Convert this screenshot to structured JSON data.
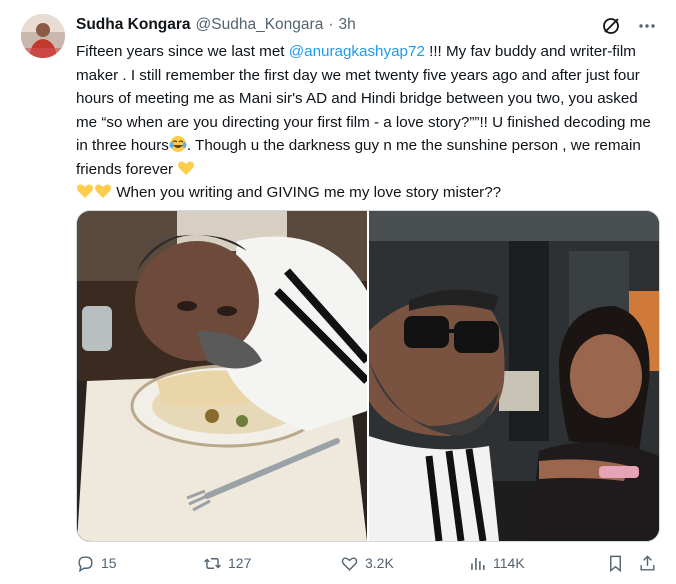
{
  "author": {
    "name": "Sudha Kongara",
    "handle": "@Sudha_Kongara",
    "separator": "·",
    "time": "3h"
  },
  "tweet": {
    "text_part1": "Fifteen years since we last met ",
    "mention": "@anuragkashyap72",
    "text_part2": " !!! My fav buddy and writer-film maker . I still remember the first day we met twenty five years ago and after just four hours of meeting me as Mani sir's AD and Hindi bridge between you two, you asked me “so when are you directing your first film - a love story?””!! U finished decoding me in three hours",
    "text_part3": ". Though u the darkness guy n me the sunshine person , we remain friends forever ",
    "text_part4": " When you writing and GIVING me my love story mister??"
  },
  "icons": {
    "grok": "grok-slash-icon",
    "more": "more-dots-icon",
    "emoji_laugh": "face-with-tears-of-joy-emoji",
    "emoji_heart": "yellow-heart-emoji"
  },
  "actions": {
    "replies": "15",
    "retweets": "127",
    "likes": "3.2K",
    "views": "114K"
  },
  "colors": {
    "accent": "#1d9bf0",
    "secondary_text": "#536471",
    "border": "#cfd9de",
    "heart_emoji": "#ffcc4d"
  }
}
